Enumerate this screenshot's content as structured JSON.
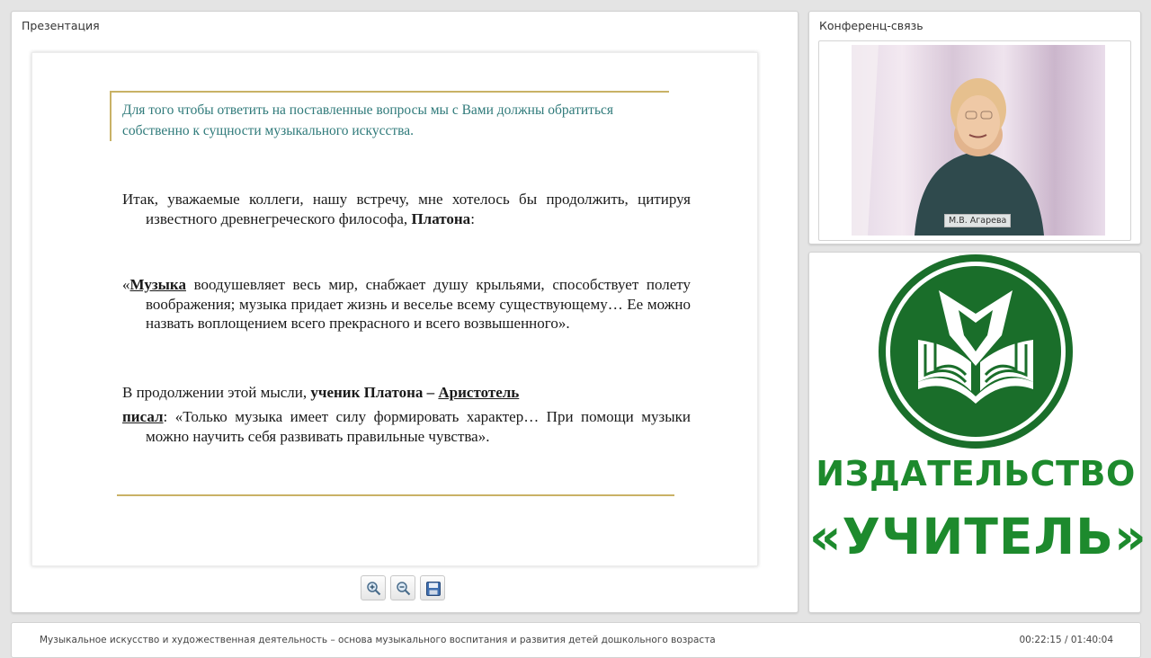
{
  "presentation": {
    "title": "Презентация",
    "slide": {
      "header": "Для того чтобы ответить на поставленные вопросы мы с Вами должны обратиться собственно к сущности музыкального искусства.",
      "para1_text": "Итак, уважаемые коллеги, нашу встречу,  мне хотелось бы продолжить, цитируя известного древнегреческого философа, ",
      "para1_bold": "Платона",
      "para1_end": ":",
      "para2_open": "«",
      "para2_bold": "Музыка",
      "para2_text": " воодушевляет весь мир, снабжает душу крыльями, способствует полету воображения; музыка придает жизнь и веселье всему существующему… Ее можно назвать воплощением всего прекрасного и всего возвышенного».",
      "para3_text": "В продолжении этой мысли,  ",
      "para3_bold": "ученик Платона – ",
      "para3_bold_u": "Аристотель",
      "para4_bold_u": "писал",
      "para4_text": ":  «Только музыка имеет силу формировать характер… При помощи музыки можно научить себя развивать правильные чувства»."
    },
    "toolbar": {
      "zoom_in": "zoom-in-icon",
      "zoom_out": "zoom-out-icon",
      "save": "save-icon"
    }
  },
  "conference": {
    "title": "Конференц-связь",
    "participant_name": "М.В. Агарева"
  },
  "logo": {
    "line1": "ИЗДАТЕЛЬСТВО",
    "line2": "«УЧИТЕЛЬ»",
    "color": "#1a6e2a"
  },
  "footer": {
    "course_title": "Музыкальное искусство и художественная деятельность – основа музыкального воспитания и развития детей дошкольного возраста",
    "timer": "00:22:15 / 01:40:04"
  }
}
